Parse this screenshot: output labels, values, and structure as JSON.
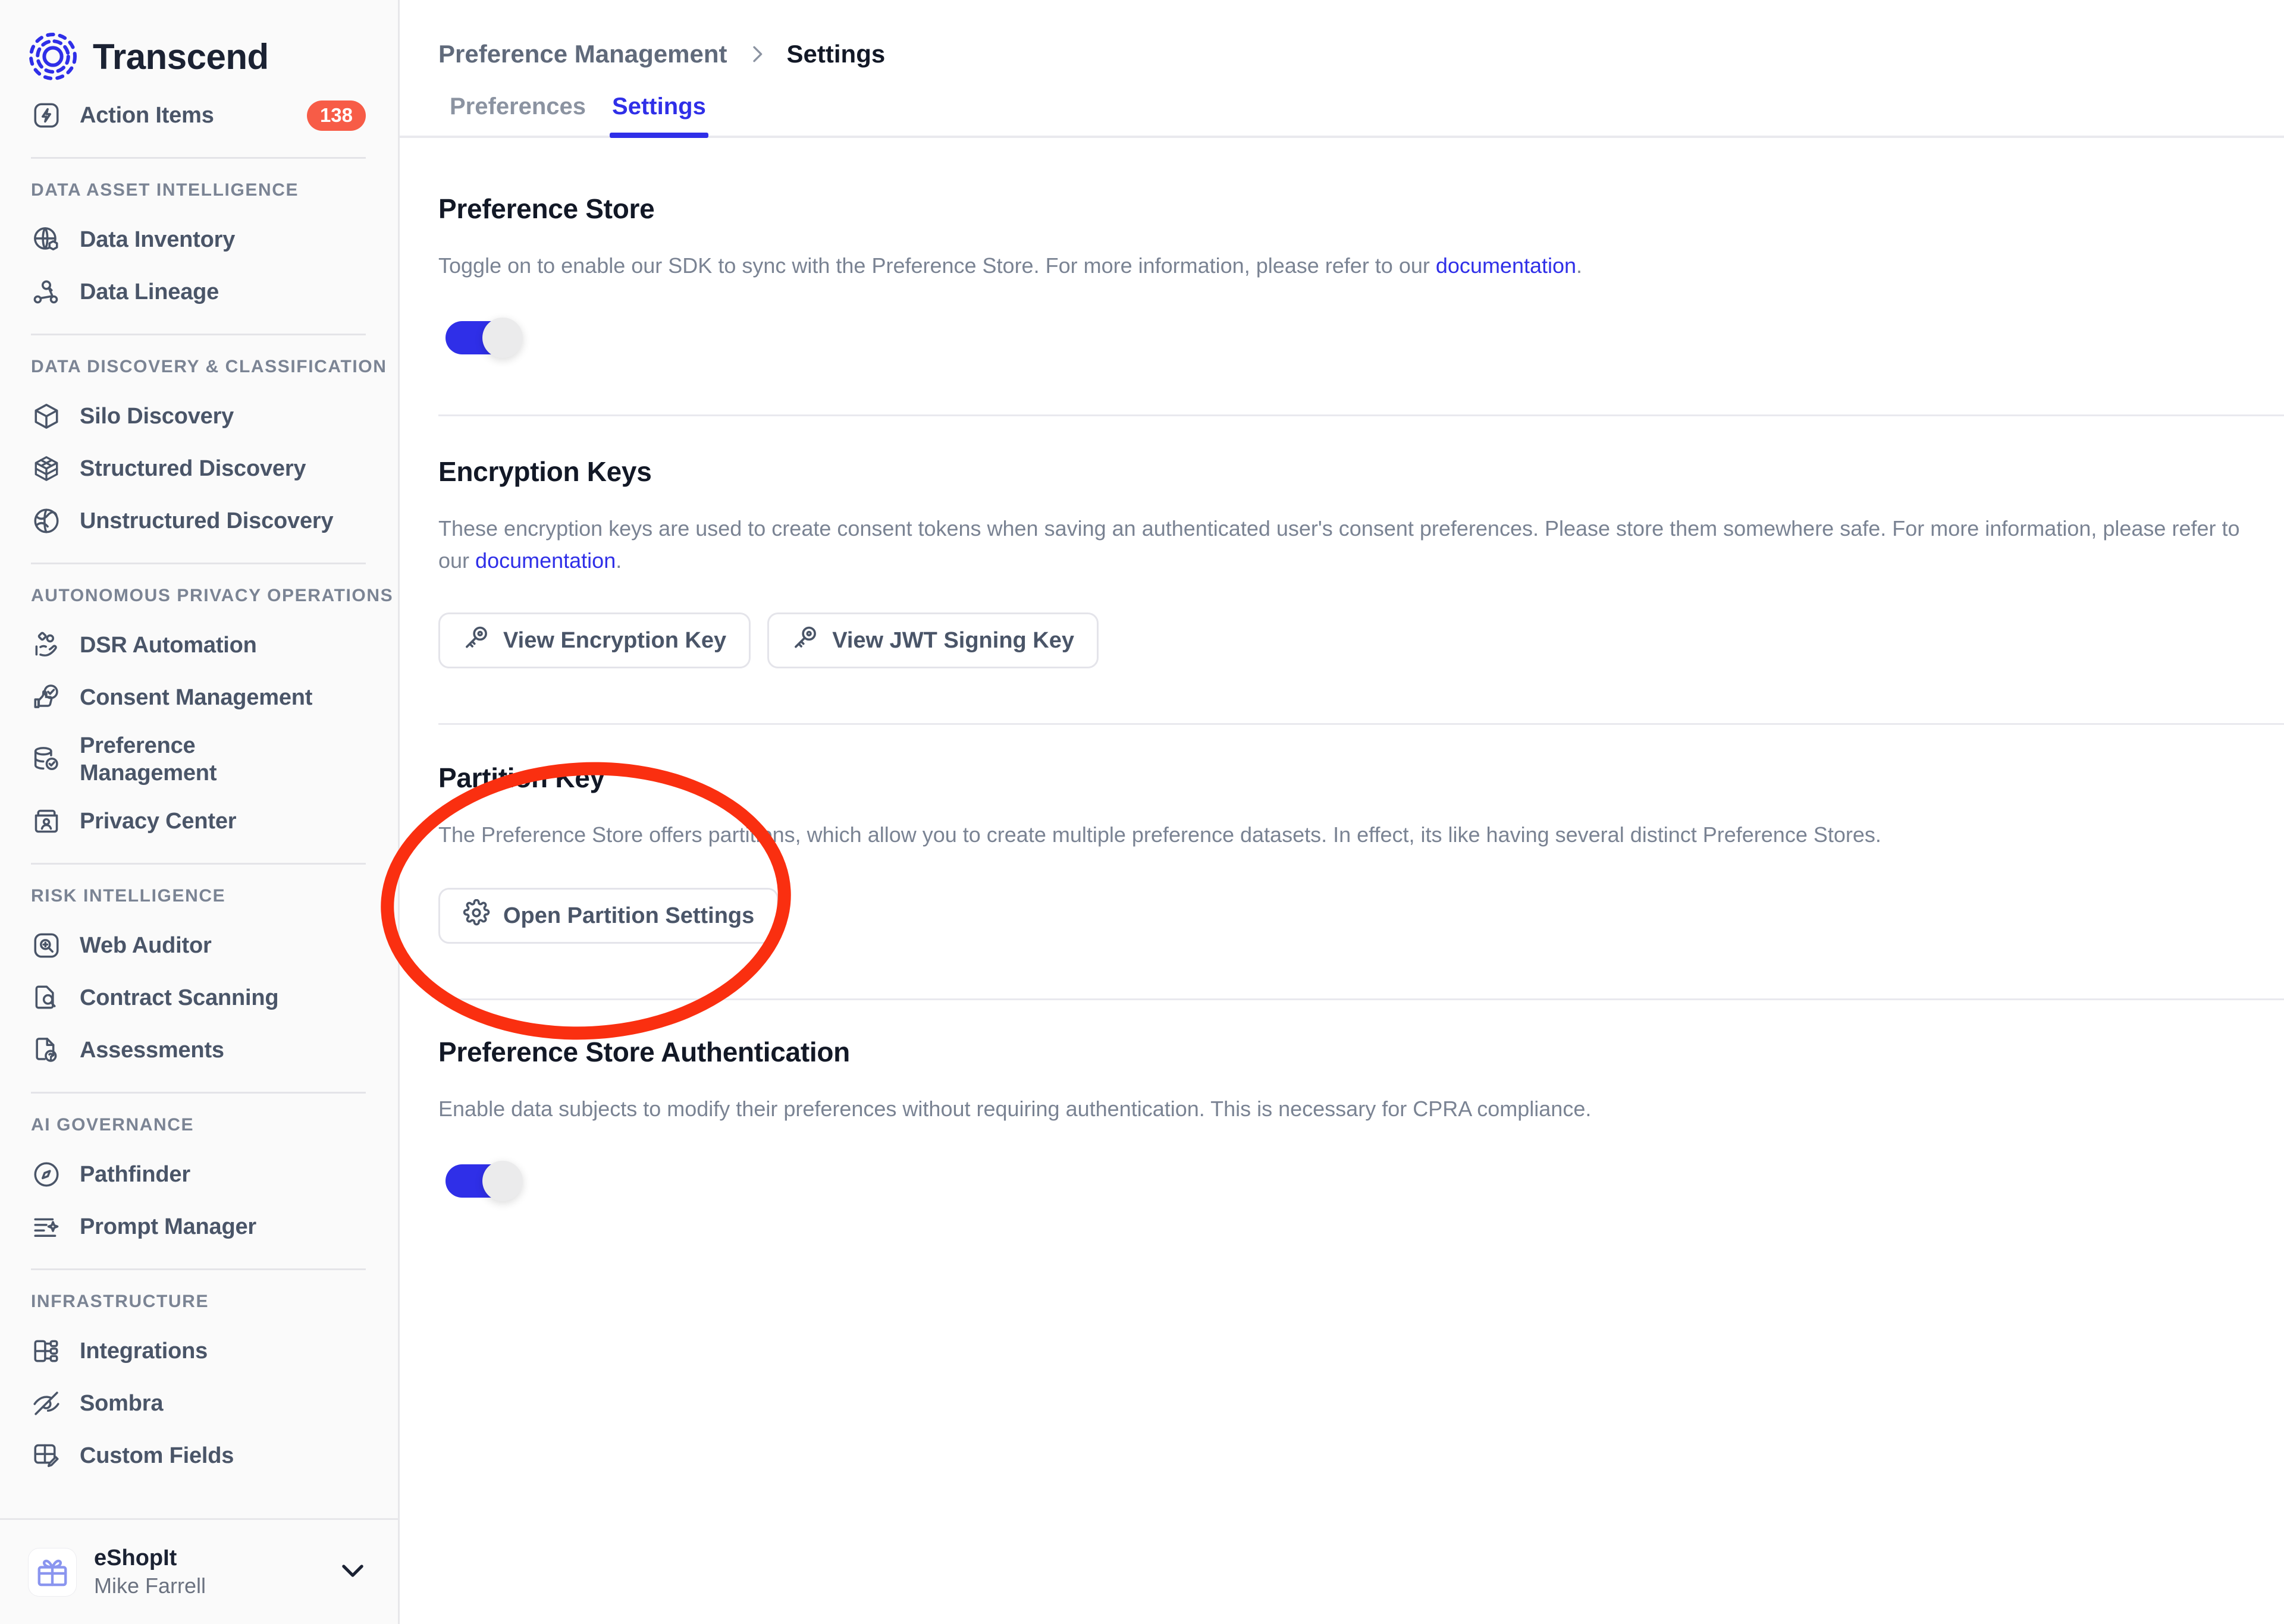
{
  "sidebar": {
    "brand": {
      "name": "Transcend",
      "logo_icon": "transcend-logo-icon"
    },
    "action_items": {
      "label": "Action Items",
      "badge": "138",
      "icon": "bolt-square-icon"
    },
    "sections": [
      {
        "title": "DATA ASSET INTELLIGENCE",
        "items": [
          {
            "label": "Data Inventory",
            "icon": "globe-cube-icon"
          },
          {
            "label": "Data Lineage",
            "icon": "lineage-nodes-icon"
          }
        ]
      },
      {
        "title": "DATA DISCOVERY & CLASSIFICATION",
        "items": [
          {
            "label": "Silo Discovery",
            "icon": "cube-icon"
          },
          {
            "label": "Structured Discovery",
            "icon": "grid-cube-icon"
          },
          {
            "label": "Unstructured Discovery",
            "icon": "globe-scan-icon"
          }
        ]
      },
      {
        "title": "AUTONOMOUS PRIVACY OPERATIONS",
        "items": [
          {
            "label": "DSR Automation",
            "icon": "hand-data-icon"
          },
          {
            "label": "Consent Management",
            "icon": "thumbs-up-check-icon"
          },
          {
            "label": "Preference Management",
            "icon": "database-check-icon"
          },
          {
            "label": "Privacy Center",
            "icon": "id-card-icon"
          }
        ]
      },
      {
        "title": "RISK INTELLIGENCE",
        "items": [
          {
            "label": "Web Auditor",
            "icon": "magnifier-square-icon"
          },
          {
            "label": "Contract Scanning",
            "icon": "document-search-icon"
          },
          {
            "label": "Assessments",
            "icon": "document-question-icon"
          }
        ]
      },
      {
        "title": "AI GOVERNANCE",
        "items": [
          {
            "label": "Pathfinder",
            "icon": "compass-icon"
          },
          {
            "label": "Prompt Manager",
            "icon": "lines-sparkle-icon"
          }
        ]
      },
      {
        "title": "INFRASTRUCTURE",
        "items": [
          {
            "label": "Integrations",
            "icon": "integrations-icon"
          },
          {
            "label": "Sombra",
            "icon": "eye-off-icon"
          },
          {
            "label": "Custom Fields",
            "icon": "grid-pencil-icon"
          }
        ]
      }
    ],
    "footer": {
      "org_name": "eShopIt",
      "user_name": "Mike Farrell",
      "avatar_icon": "gift-icon",
      "chevron_icon": "chevron-down-icon"
    }
  },
  "breadcrumb": {
    "parent": "Preference Management",
    "separator": "›",
    "current": "Settings"
  },
  "tabs": [
    {
      "label": "Preferences",
      "active": false
    },
    {
      "label": "Settings",
      "active": true
    }
  ],
  "sections": {
    "preference_store": {
      "title": "Preference Store",
      "desc_before": "Toggle on to enable our SDK to sync with the Preference Store. For more information, please refer to our ",
      "link": "documentation",
      "desc_after": ".",
      "toggle_state": "on"
    },
    "encryption_keys": {
      "title": "Encryption Keys",
      "desc_before": "These encryption keys are used to create consent tokens when saving an authenticated user's consent preferences. Please store them somewhere safe. For more information, please refer to our ",
      "link": "documentation",
      "desc_after": ".",
      "buttons": [
        {
          "label": "View Encryption Key",
          "icon": "key-icon"
        },
        {
          "label": "View JWT Signing Key",
          "icon": "key-icon"
        }
      ]
    },
    "partition_key": {
      "title": "Partition Key",
      "desc": "The Preference Store offers partitions, which allow you to create multiple preference datasets. In effect, its like having several distinct Preference Stores.",
      "button": {
        "label": "Open Partition Settings",
        "icon": "gear-icon"
      }
    },
    "preference_store_auth": {
      "title": "Preference Store Authentication",
      "desc": "Enable data subjects to modify their preferences without requiring authentication. This is necessary for CPRA compliance.",
      "toggle_state": "on"
    }
  },
  "annotation": {
    "shape": "ellipse",
    "color": "#fa2f10",
    "target": "Open Partition Settings"
  },
  "colors": {
    "accent": "#2f2fe8",
    "badge": "#f75c47",
    "annotation": "#fa2f10",
    "text_dark": "#121826",
    "text_muted": "#7a8393",
    "sidebar_bg": "#fafafa"
  }
}
